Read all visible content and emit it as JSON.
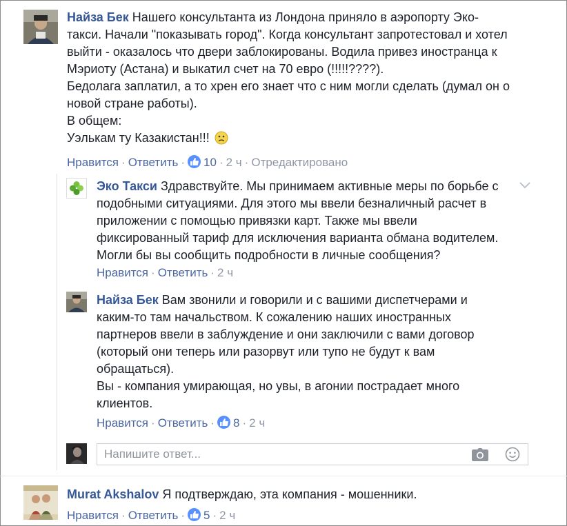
{
  "comments": [
    {
      "author": "Найза Бек",
      "lines": [
        "Нашего консультанта из Лондона приняло в аэропорту Эко-",
        "такси. Начали \"показывать город\". Когда консультант запротестовал и хотел",
        "выйти - оказалось что двери заблокированы. Водила привез иностранца к",
        "Мэриоту (Астана) и выкатил счет на 70 евро (!!!!!????).",
        "Бедолага заплатил, а то хрен его знает что с ним могли сделать (думал он о",
        "новой стране работы).",
        "В общем:",
        "Уэлькам ту Казакистан!!!"
      ],
      "like": "Нравится",
      "reply": "Ответить",
      "likes": "10",
      "time": "2 ч",
      "edited": "Отредактировано"
    },
    {
      "author": "Эко Такси",
      "lines": [
        "Здравствуйте. Мы принимаем активные меры по борьбе с",
        "подобными ситуациями. Для этого мы ввели безналичный расчет в",
        "приложении с помощью привязки карт. Также мы ввели",
        "фиксированный тариф для исключения варианта обмана водителем.",
        "Могли бы вы сообщить подробности в личные сообщения?"
      ],
      "like": "Нравится",
      "reply": "Ответить",
      "time": "2 ч"
    },
    {
      "author": "Найза Бек",
      "lines": [
        "Вам звонили и говорили и с вашими диспетчерами и",
        "каким-то там начальством. К сожалению наших иностранных",
        "партнеров ввели в заблуждение и они заключили с вами договор",
        "(который они теперь или разорвут или тупо не будут к вам",
        "обращаться).",
        "Вы - компания умирающая, но увы, в агонии пострадает много",
        "клиентов."
      ],
      "like": "Нравится",
      "reply": "Ответить",
      "likes": "8",
      "time": "2 ч"
    },
    {
      "author": "Murat Akshalov",
      "lines": [
        "Я подтверждаю, эта компания - мошенники."
      ],
      "like": "Нравится",
      "reply": "Ответить",
      "likes": "5",
      "time": "2 ч"
    }
  ],
  "reply_box": {
    "placeholder": "Напишите ответ..."
  },
  "colors": {
    "link": "#365899",
    "meta": "#90949c",
    "like_badge": "#5890ff"
  },
  "icons": [
    "smiley-frown-icon",
    "chevron-down-icon",
    "thumbs-up-icon",
    "camera-icon",
    "smiley-icon"
  ]
}
